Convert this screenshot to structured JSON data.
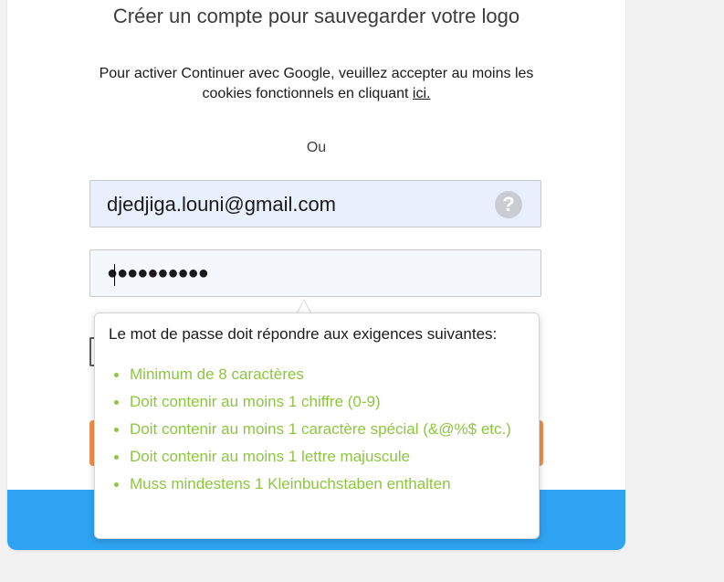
{
  "form": {
    "title": "Créer un compte pour sauvegarder votre logo",
    "cookie_note_text": "Pour activer Continuer avec Google, veuillez accepter au moins les cookies fonctionnels en cliquant",
    "cookie_link": "ici.",
    "or_label": "Ou",
    "email_value": "djedjiga.louni@gmail.com",
    "help_icon_glyph": "?",
    "password_mask": "●●●●●●●●●●"
  },
  "tooltip": {
    "title": "Le mot de passe doit répondre aux exigences suivantes:",
    "requirements": [
      "Minimum de 8 caractères",
      "Doit contenir au moins 1 chiffre (0-9)",
      "Doit contenir au moins 1 caractère spécial (&@%$ etc.)",
      "Doit contenir au moins 1 lettre majuscule",
      "Muss mindestens 1 Kleinbuchstaben enthalten"
    ]
  },
  "colors": {
    "accent_blue": "#2ea3f2",
    "requirement_green": "#8cc63f",
    "button_orange": "#f08f4d"
  }
}
